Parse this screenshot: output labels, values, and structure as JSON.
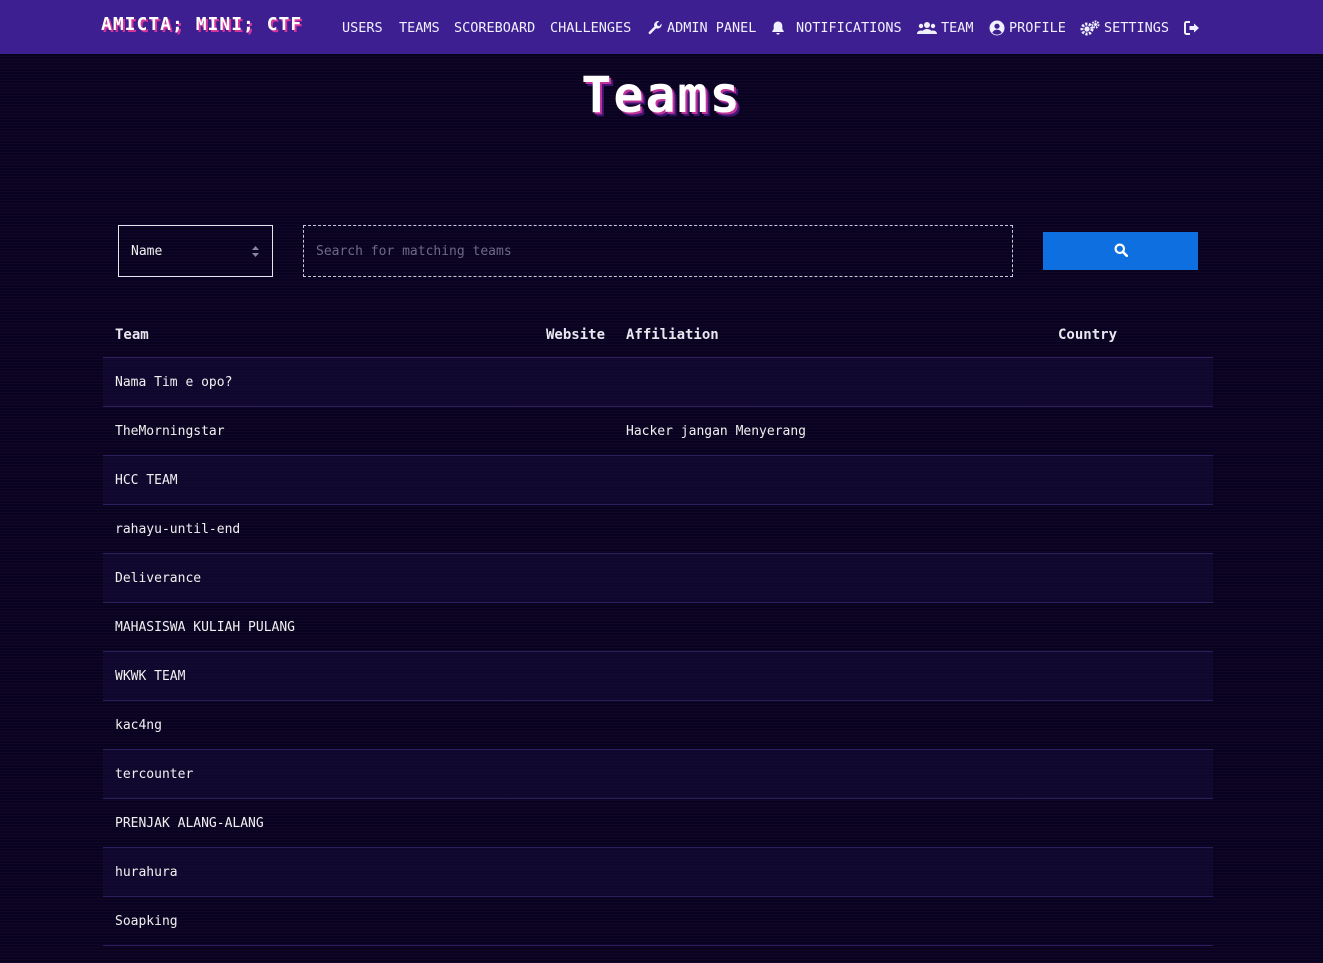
{
  "nav": {
    "brand": "AMICTA; MINI; CTF",
    "items": [
      {
        "label": "USERS",
        "icon": ""
      },
      {
        "label": "TEAMS",
        "icon": ""
      },
      {
        "label": "SCOREBOARD",
        "icon": ""
      },
      {
        "label": "CHALLENGES",
        "icon": ""
      },
      {
        "label": "ADMIN PANEL",
        "icon": "wrench-icon"
      },
      {
        "label": "NOTIFICATIONS",
        "icon": "bell-icon"
      },
      {
        "label": "TEAM",
        "icon": "users-icon"
      },
      {
        "label": "PROFILE",
        "icon": "user-circle-icon"
      },
      {
        "label": "SETTINGS",
        "icon": "gears-icon"
      },
      {
        "label": "",
        "icon": "logout-icon"
      }
    ]
  },
  "page": {
    "title": "Teams"
  },
  "search": {
    "field_selected": "Name",
    "placeholder": "Search for matching teams",
    "button_icon": "search-icon",
    "accent_color": "#0d6fe0"
  },
  "table": {
    "headers": {
      "team": "Team",
      "website": "Website",
      "affiliation": "Affiliation",
      "country": "Country"
    },
    "rows": [
      {
        "team": "Nama Tim e opo?",
        "affiliation": ""
      },
      {
        "team": "TheMorningstar",
        "affiliation": "Hacker jangan Menyerang"
      },
      {
        "team": "HCC TEAM",
        "affiliation": ""
      },
      {
        "team": "rahayu-until-end",
        "affiliation": ""
      },
      {
        "team": "Deliverance",
        "affiliation": ""
      },
      {
        "team": "MAHASISWA KULIAH PULANG",
        "affiliation": ""
      },
      {
        "team": "WKWK TEAM",
        "affiliation": ""
      },
      {
        "team": "kac4ng",
        "affiliation": ""
      },
      {
        "team": "tercounter",
        "affiliation": ""
      },
      {
        "team": "PRENJAK ALANG-ALANG",
        "affiliation": ""
      },
      {
        "team": "hurahura",
        "affiliation": ""
      },
      {
        "team": "Soapking",
        "affiliation": ""
      }
    ]
  }
}
